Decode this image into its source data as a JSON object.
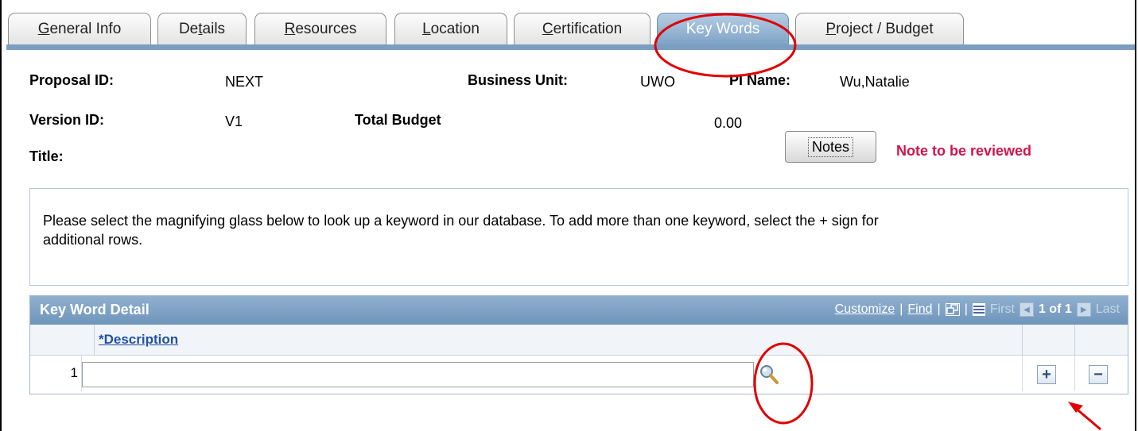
{
  "tabs": [
    {
      "label": "General Info",
      "ul": "G",
      "rest": "eneral Info"
    },
    {
      "label": "Details",
      "ul_pre": "De",
      "ul": "t",
      "rest": "ails"
    },
    {
      "label": "Resources",
      "ul": "R",
      "rest": "esources"
    },
    {
      "label": "Location",
      "ul": "L",
      "rest": "ocation"
    },
    {
      "label": "Certification",
      "ul": "C",
      "rest": "ertification"
    },
    {
      "label": "Key Words",
      "active": true
    },
    {
      "label": "Project / Budget",
      "ul": "P",
      "rest": "roject / Budget"
    }
  ],
  "header": {
    "proposal_id_label": "Proposal ID:",
    "proposal_id_value": "NEXT",
    "business_unit_label": "Business Unit:",
    "business_unit_value": "UWO",
    "pi_name_label": "PI Name:",
    "pi_name_value": "Wu,Natalie",
    "version_id_label": "Version ID:",
    "version_id_value": "V1",
    "total_budget_label": "Total Budget",
    "total_budget_value": "0.00",
    "title_label": "Title:",
    "notes_button": "Notes",
    "note_status": "Note to be reviewed"
  },
  "instructions": "Please select the magnifying glass below to look up a keyword in our database. To add more than one keyword, select the + sign for additional rows.",
  "grid": {
    "title": "Key Word Detail",
    "customize": "Customize",
    "find": "Find",
    "first": "First",
    "count": "1 of 1",
    "last": "Last",
    "column_description": "*Description",
    "rows": [
      {
        "num": "1",
        "description": ""
      }
    ]
  },
  "colors": {
    "accent": "#7b9ec0",
    "alert": "#d0154a",
    "annotation": "#e00000"
  }
}
